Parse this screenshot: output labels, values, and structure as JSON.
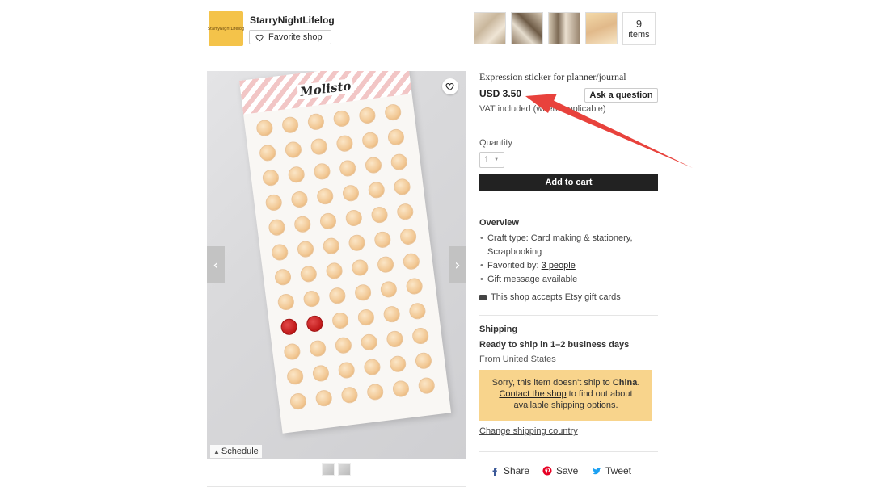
{
  "shop": {
    "name": "StarryNightLifelog",
    "logo_text": "StarryNightLifelog",
    "favorite_label": "Favorite shop",
    "items_count": "9",
    "items_label": "items"
  },
  "listing": {
    "title": "Expression sticker for planner/journal",
    "price": "USD 3.50",
    "ask_label": "Ask a question",
    "vat_text": "VAT included (where applicable)",
    "quantity_label": "Quantity",
    "quantity_value": "1",
    "add_to_cart": "Add to cart",
    "image_sheet_title": "Molisto",
    "schedule_label": "Schedule",
    "prev_arrow": "‹",
    "next_arrow": "›"
  },
  "overview": {
    "heading": "Overview",
    "craft_type": "Craft type: Card making & stationery, Scrapbooking",
    "favorited_prefix": "Favorited by: ",
    "favorited_link": "3 people",
    "gift_message": "Gift message available",
    "gift_cards": "This shop accepts Etsy gift cards"
  },
  "shipping": {
    "heading": "Shipping",
    "ready": "Ready to ship in 1–2 business days",
    "from": "From United States",
    "notice_pre": "Sorry, this item doesn't ship to ",
    "notice_country": "China",
    "notice_sep": ". ",
    "notice_link": "Contact the shop",
    "notice_post": " to find out about available shipping options.",
    "change_country": "Change shipping country"
  },
  "social": {
    "share": "Share",
    "save": "Save",
    "tweet": "Tweet"
  },
  "colors": {
    "accent_arrow": "#e8423c",
    "notice_bg": "#f8d48c",
    "cart_bg": "#222222"
  }
}
